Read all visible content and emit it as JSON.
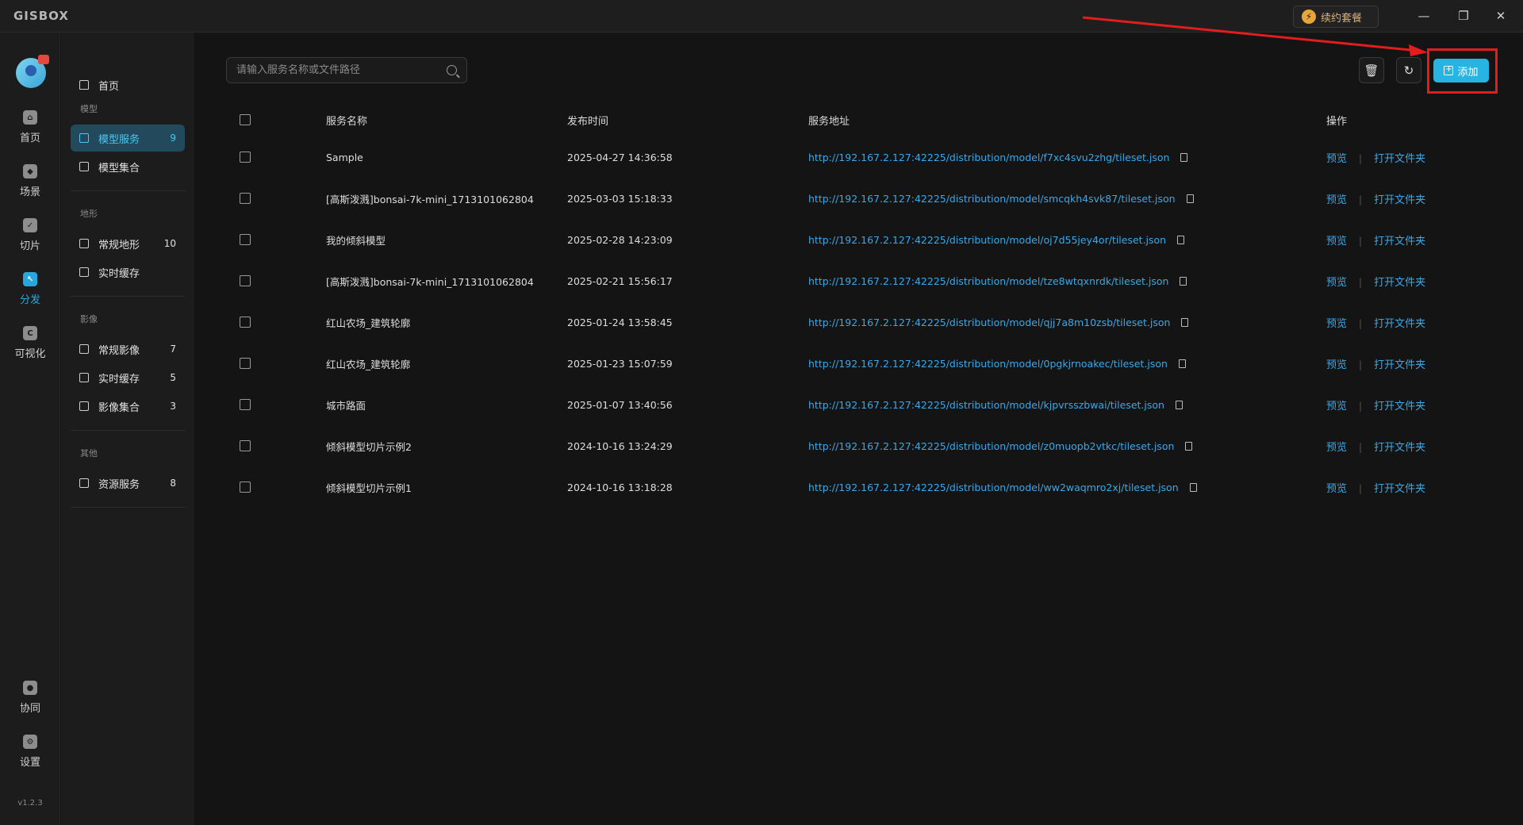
{
  "app": {
    "logo": "GISBOX",
    "renew_label": "续约套餐",
    "version": "v1.2.3"
  },
  "window_controls": [
    "—",
    "❐",
    "✕"
  ],
  "rail": {
    "items": [
      {
        "label": "首页",
        "icon": "home-icon"
      },
      {
        "label": "场景",
        "icon": "scene-icon"
      },
      {
        "label": "切片",
        "icon": "slice-icon"
      },
      {
        "label": "分发",
        "icon": "distribute-icon",
        "active": true
      },
      {
        "label": "可视化",
        "icon": "visualize-icon"
      }
    ],
    "bottom_items": [
      {
        "label": "协同",
        "icon": "collab-icon"
      },
      {
        "label": "设置",
        "icon": "settings-icon"
      }
    ]
  },
  "subnav": {
    "home": "首页",
    "groups": [
      {
        "title": "模型",
        "items": [
          {
            "label": "模型服务",
            "count": "9",
            "active": true
          },
          {
            "label": "模型集合",
            "count": ""
          }
        ]
      },
      {
        "title": "地形",
        "items": [
          {
            "label": "常规地形",
            "count": "10"
          },
          {
            "label": "实时缓存",
            "count": ""
          }
        ]
      },
      {
        "title": "影像",
        "items": [
          {
            "label": "常规影像",
            "count": "7"
          },
          {
            "label": "实时缓存",
            "count": "5"
          },
          {
            "label": "影像集合",
            "count": "3"
          }
        ]
      },
      {
        "title": "其他",
        "items": [
          {
            "label": "资源服务",
            "count": "8"
          }
        ]
      }
    ]
  },
  "toolbar": {
    "search_placeholder": "请输入服务名称或文件路径",
    "add_label": "添加"
  },
  "table": {
    "headers": {
      "name": "服务名称",
      "time": "发布时间",
      "url": "服务地址",
      "ops": "操作"
    },
    "op_preview": "预览",
    "op_open_folder": "打开文件夹",
    "rows": [
      {
        "name": "Sample",
        "time": "2025-04-27 14:36:58",
        "url": "http://192.167.2.127:42225/distribution/model/f7xc4svu2zhg/tileset.json"
      },
      {
        "name": "[高斯泼溅]bonsai-7k-mini_1713101062804",
        "time": "2025-03-03 15:18:33",
        "url": "http://192.167.2.127:42225/distribution/model/smcqkh4svk87/tileset.json"
      },
      {
        "name": "我的倾斜模型",
        "time": "2025-02-28 14:23:09",
        "url": "http://192.167.2.127:42225/distribution/model/oj7d55jey4or/tileset.json"
      },
      {
        "name": "[高斯泼溅]bonsai-7k-mini_1713101062804",
        "time": "2025-02-21 15:56:17",
        "url": "http://192.167.2.127:42225/distribution/model/tze8wtqxnrdk/tileset.json"
      },
      {
        "name": "红山农场_建筑轮廓",
        "time": "2025-01-24 13:58:45",
        "url": "http://192.167.2.127:42225/distribution/model/qjj7a8m10zsb/tileset.json"
      },
      {
        "name": "红山农场_建筑轮廓",
        "time": "2025-01-23 15:07:59",
        "url": "http://192.167.2.127:42225/distribution/model/0pgkjrnoakec/tileset.json"
      },
      {
        "name": "城市路面",
        "time": "2025-01-07 13:40:56",
        "url": "http://192.167.2.127:42225/distribution/model/kjpvrsszbwai/tileset.json"
      },
      {
        "name": "倾斜模型切片示例2",
        "time": "2024-10-16 13:24:29",
        "url": "http://192.167.2.127:42225/distribution/model/z0muopb2vtkc/tileset.json"
      },
      {
        "name": "倾斜模型切片示例1",
        "time": "2024-10-16 13:18:28",
        "url": "http://192.167.2.127:42225/distribution/model/ww2waqmro2xj/tileset.json"
      }
    ]
  },
  "colors": {
    "accent": "#28b4e2",
    "link": "#3aa8e8",
    "annotation": "#e21d1d"
  }
}
